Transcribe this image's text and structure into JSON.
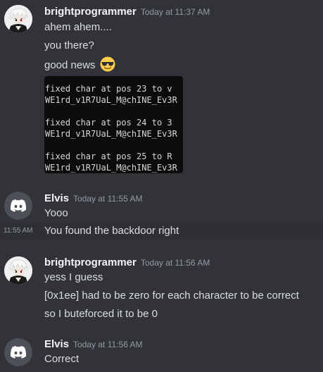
{
  "messages": [
    {
      "author": "brightprogrammer",
      "timestamp": "Today at 11:37 AM",
      "lines": [
        "ahem ahem....",
        "you there?",
        "good news"
      ],
      "emoji": "smiling-face-with-sunglasses",
      "code": [
        "fixed char at pos 23 to v",
        "WE1rd_v1R7UaL_M@chINE_Ev3R",
        "",
        "fixed char at pos 24 to 3",
        "WE1rd_v1R7UaL_M@chINE_Ev3R",
        "",
        "fixed char at pos 25 to R",
        "WE1rd_v1R7UaL_M@chINE_Ev3R"
      ]
    },
    {
      "author": "Elvis",
      "timestamp": "Today at 11:55 AM",
      "lines": [
        "Yooo",
        "You found the backdoor right"
      ],
      "hover_time": "11:55 AM"
    },
    {
      "author": "brightprogrammer",
      "timestamp": "Today at 11:56 AM",
      "lines": [
        "yess I guess",
        "[0x1ee] had to be zero for each character to be correct",
        "so I buteforced it to be 0"
      ]
    },
    {
      "author": "Elvis",
      "timestamp": "Today at 11:56 AM",
      "lines": [
        "Correct"
      ]
    }
  ],
  "colors": {
    "background": "#313338",
    "username": "#f2f3f5",
    "text": "#dbdee1",
    "muted": "#949ba4",
    "discord_avatar_bg": "#4e5058"
  }
}
